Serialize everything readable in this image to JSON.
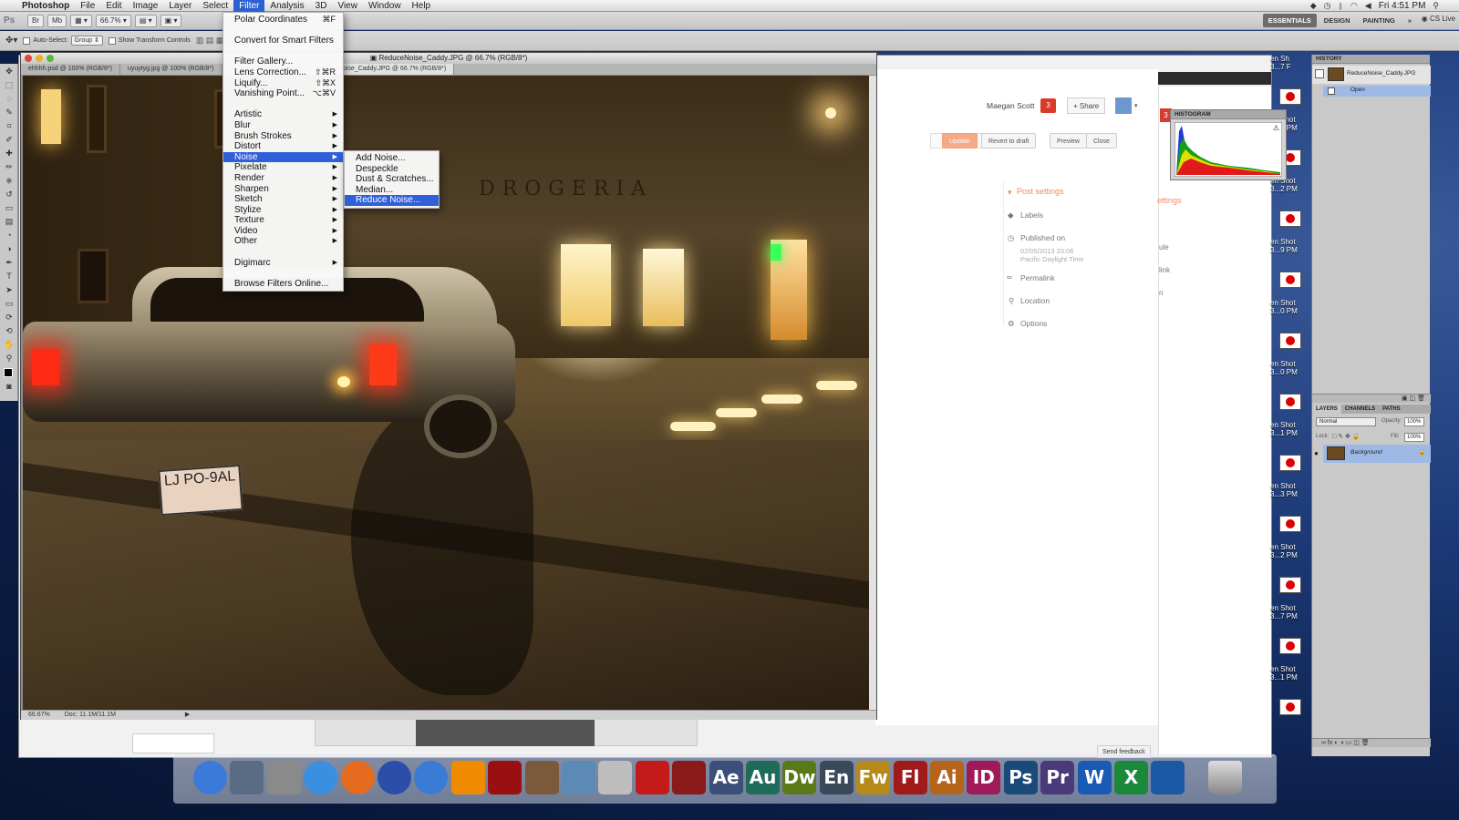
{
  "menubar": {
    "apple": "",
    "app": "Photoshop",
    "items": [
      "File",
      "Edit",
      "Image",
      "Layer",
      "Select",
      "Filter",
      "Analysis",
      "3D",
      "View",
      "Window",
      "Help"
    ],
    "active": "Filter",
    "clock": "Fri 4:51 PM"
  },
  "appbar": {
    "ps_logo": "Ps",
    "zoom": "66.7",
    "workspaces": [
      "ESSENTIALS",
      "DESIGN",
      "PAINTING"
    ],
    "more": "»",
    "cs_live": "CS Live"
  },
  "optbar": {
    "auto_select": "Auto-Select:",
    "group": "Group",
    "transform": "Show Transform Controls"
  },
  "filter_menu": {
    "items": [
      {
        "label": "Polar Coordinates",
        "shortcut": "⌘F"
      },
      {
        "sep": true
      },
      {
        "label": "Convert for Smart Filters"
      },
      {
        "sep": true
      },
      {
        "label": "Filter Gallery..."
      },
      {
        "label": "Lens Correction...",
        "shortcut": "⇧⌘R"
      },
      {
        "label": "Liquify...",
        "shortcut": "⇧⌘X"
      },
      {
        "label": "Vanishing Point...",
        "shortcut": "⌥⌘V"
      },
      {
        "sep": true
      },
      {
        "label": "Artistic",
        "sub": true
      },
      {
        "label": "Blur",
        "sub": true
      },
      {
        "label": "Brush Strokes",
        "sub": true
      },
      {
        "label": "Distort",
        "sub": true
      },
      {
        "label": "Noise",
        "sub": true,
        "hl": true
      },
      {
        "label": "Pixelate",
        "sub": true
      },
      {
        "label": "Render",
        "sub": true
      },
      {
        "label": "Sharpen",
        "sub": true
      },
      {
        "label": "Sketch",
        "sub": true
      },
      {
        "label": "Stylize",
        "sub": true
      },
      {
        "label": "Texture",
        "sub": true
      },
      {
        "label": "Video",
        "sub": true
      },
      {
        "label": "Other",
        "sub": true
      },
      {
        "sep": true
      },
      {
        "label": "Digimarc",
        "sub": true
      },
      {
        "sep": true
      },
      {
        "label": "Browse Filters Online..."
      }
    ]
  },
  "noise_menu": {
    "items": [
      {
        "label": "Add Noise..."
      },
      {
        "label": "Despeckle"
      },
      {
        "label": "Dust & Scratches..."
      },
      {
        "label": "Median..."
      },
      {
        "label": "Reduce Noise...",
        "hl": true
      }
    ]
  },
  "document": {
    "title": "ReduceNoise_Caddy.JPG @ 66.7% (RGB/8*)",
    "tabs": [
      {
        "label": "ehhhh.psd @ 100% (RGB/8*)"
      },
      {
        "label": "uyuytyg.jpg @ 100% (RGB/8*)"
      },
      {
        "label": "Shape 1, RGB/8*/CMYK)"
      },
      {
        "label": "ReduceNoise_Caddy.JPG @ 66.7% (RGB/8*)",
        "active": true
      }
    ],
    "status_zoom": "66.67%",
    "status_doc": "Doc: 11.1M/11.1M",
    "storefront": "DROGERIA",
    "plate": "LJ PO-9AL"
  },
  "blogger": {
    "user": "Maegan Scott",
    "notif": "3",
    "share": "+ Share",
    "buttons": [
      "Update",
      "Revert to draft",
      "Preview",
      "Close"
    ],
    "post_settings": "Post settings",
    "labels": "Labels",
    "published_on": "Published on",
    "date": "02/05/2013 23:06",
    "tz": "Pacific Daylight Time",
    "permalink": "Permalink",
    "location": "Location",
    "options": "Options",
    "feedback": "Send feedback",
    "partial": "ettings",
    "partial_items": [
      "ule",
      "link",
      "n"
    ]
  },
  "shots": [
    {
      "line1": "en Sh",
      "line2": "3...7 F"
    },
    {
      "line1": "en Shot",
      "line2": "3...1 PM"
    },
    {
      "line1": "en Shot",
      "line2": "3...2 PM"
    },
    {
      "line1": "en Shot",
      "line2": "3...9 PM"
    },
    {
      "line1": "en Shot",
      "line2": "3...0 PM"
    },
    {
      "line1": "en Shot",
      "line2": "3...0 PM"
    },
    {
      "line1": "en Shot",
      "line2": "3...1 PM"
    },
    {
      "line1": "en Shot",
      "line2": "3...3 PM"
    },
    {
      "line1": "en Shot",
      "line2": "3...2 PM"
    },
    {
      "line1": "en Shot",
      "line2": "3...7 PM"
    },
    {
      "line1": "en Shot",
      "line2": "3...1 PM"
    }
  ],
  "panels": {
    "history": "HISTORY",
    "history_file": "ReduceNoise_Caddy.JPG",
    "history_step": "Open",
    "histogram": "HISTOGRAM",
    "layers_tabs": [
      "LAYERS",
      "CHANNELS",
      "PATHS"
    ],
    "blend": "Normal",
    "opacity_label": "Opacity:",
    "opacity": "100%",
    "lock_label": "Lock:",
    "fill_label": "Fill:",
    "fill": "100%",
    "layer_name": "Background"
  },
  "dock": {
    "apps": [
      {
        "name": "finder",
        "label": "",
        "color": "#3b7ad9"
      },
      {
        "name": "launchpad",
        "label": "",
        "color": "#5a6b84"
      },
      {
        "name": "system-preferences",
        "label": "",
        "color": "#8a8a8a"
      },
      {
        "name": "safari",
        "label": "",
        "color": "#3b8fe0"
      },
      {
        "name": "firefox",
        "label": "",
        "color": "#e56b1f"
      },
      {
        "name": "audacity",
        "label": "",
        "color": "#2b4fa8"
      },
      {
        "name": "itunes",
        "label": "",
        "color": "#3a7bd5"
      },
      {
        "name": "vlc",
        "label": "",
        "color": "#f08a00"
      },
      {
        "name": "photo-booth",
        "label": "",
        "color": "#9a1010"
      },
      {
        "name": "iphoto",
        "label": "",
        "color": "#7a5a3a"
      },
      {
        "name": "preview",
        "label": "",
        "color": "#5a8ab5"
      },
      {
        "name": "dvd-player",
        "label": "",
        "color": "#bdbdbd"
      },
      {
        "name": "acrobat",
        "label": "",
        "color": "#c41a1a"
      },
      {
        "name": "acrobat-distiller",
        "label": "",
        "color": "#8a1a1a"
      },
      {
        "name": "after-effects",
        "label": "Ae",
        "color": "#3b4f7a"
      },
      {
        "name": "audition",
        "label": "Au",
        "color": "#1f6b5a"
      },
      {
        "name": "dreamweaver",
        "label": "Dw",
        "color": "#5a7a1a"
      },
      {
        "name": "encore",
        "label": "En",
        "color": "#3a4a5a"
      },
      {
        "name": "fireworks",
        "label": "Fw",
        "color": "#b58a1a"
      },
      {
        "name": "flash",
        "label": "Fl",
        "color": "#a01a1a"
      },
      {
        "name": "illustrator",
        "label": "Ai",
        "color": "#b5651a"
      },
      {
        "name": "indesign",
        "label": "ID",
        "color": "#a01a5a"
      },
      {
        "name": "photoshop",
        "label": "Ps",
        "color": "#1a4a7a"
      },
      {
        "name": "premiere",
        "label": "Pr",
        "color": "#4a3a7a"
      },
      {
        "name": "word",
        "label": "W",
        "color": "#1a5ab5"
      },
      {
        "name": "excel",
        "label": "X",
        "color": "#1a8a3a"
      },
      {
        "name": "home",
        "label": "",
        "color": "#1a5aa5"
      },
      {
        "name": "trash",
        "label": "",
        "color": "#aaaaaa"
      }
    ]
  }
}
